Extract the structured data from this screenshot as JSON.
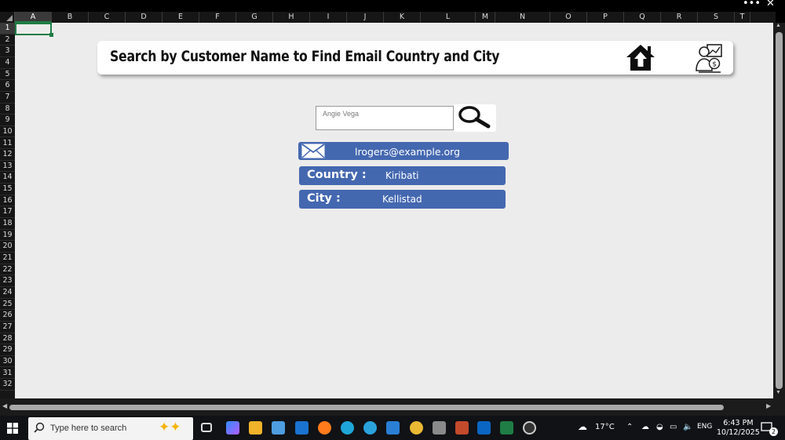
{
  "columns": [
    "A",
    "B",
    "C",
    "D",
    "E",
    "F",
    "G",
    "H",
    "I",
    "J",
    "K",
    "L",
    "M",
    "N",
    "O",
    "P",
    "Q",
    "R",
    "S",
    "T"
  ],
  "rows": [
    "1",
    "2",
    "3",
    "4",
    "5",
    "6",
    "7",
    "8",
    "9",
    "10",
    "11",
    "12",
    "13",
    "14",
    "15",
    "16",
    "17",
    "18",
    "19",
    "20",
    "21",
    "22",
    "23",
    "24",
    "25",
    "26",
    "27",
    "28",
    "29",
    "30",
    "31",
    "32"
  ],
  "window_controls": {
    "more": "•••",
    "close": "✕"
  },
  "dashboard": {
    "title": "Search by Customer Name to Find Email Country and City",
    "home_icon": "home-upload-icon",
    "profile_icon": "customer-profile-icon"
  },
  "search": {
    "value": "Angie Vega",
    "button_icon": "magnifier-icon"
  },
  "results": {
    "email": "lrogers@example.org",
    "country_label": "Country :",
    "country": "Kiribati",
    "city_label": "City :",
    "city": "Kellistad"
  },
  "colors": {
    "result_bar": "#4468b0",
    "sheet_bg": "#ececec",
    "active_cell": "#1f7d45"
  },
  "taskbar": {
    "search_placeholder": "Type here to search",
    "weather": "17°C",
    "language": "ENG",
    "time": "6:43 PM",
    "date": "10/12/2025",
    "notifications": "2"
  }
}
